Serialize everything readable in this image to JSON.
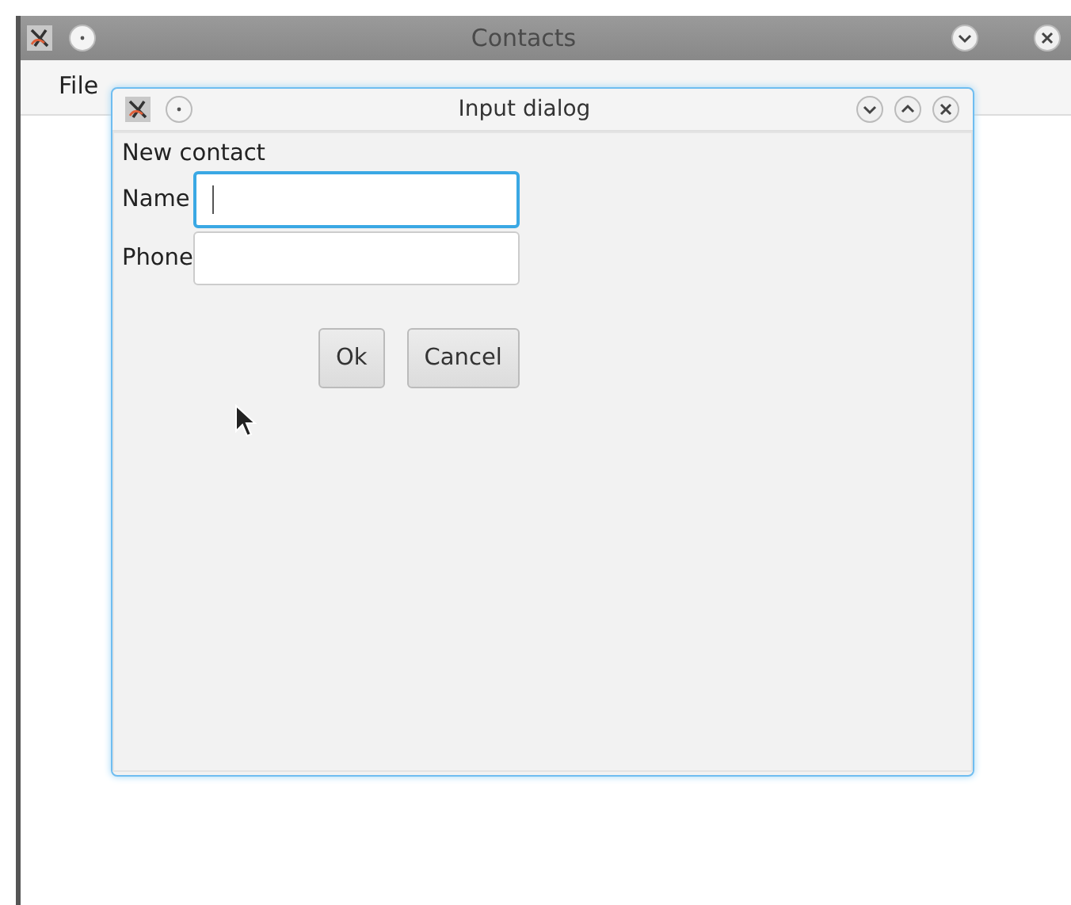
{
  "main_window": {
    "title": "Contacts",
    "menu": [
      "File"
    ]
  },
  "dialog": {
    "title": "Input dialog",
    "heading": "New contact",
    "fields": [
      {
        "label": "Name",
        "focused": true
      },
      {
        "label": "Phone",
        "focused": false
      }
    ],
    "buttons": [
      "Ok",
      "Cancel"
    ]
  }
}
